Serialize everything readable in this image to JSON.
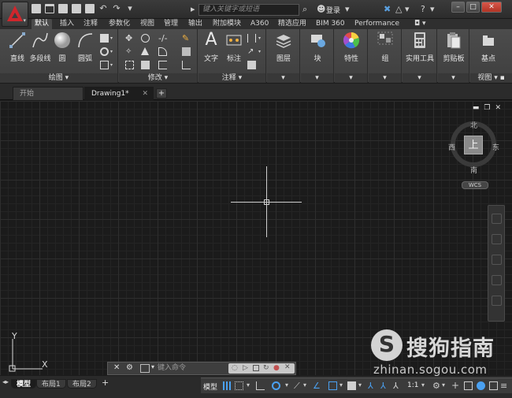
{
  "titlebar": {
    "search_placeholder": "键入关键字或短语",
    "login_label": "登录"
  },
  "ribbon_tabs": [
    {
      "label": "默认",
      "active": true
    },
    {
      "label": "插入"
    },
    {
      "label": "注释"
    },
    {
      "label": "参数化"
    },
    {
      "label": "视图"
    },
    {
      "label": "管理"
    },
    {
      "label": "输出"
    },
    {
      "label": "附加模块"
    },
    {
      "label": "A360"
    },
    {
      "label": "精选应用"
    },
    {
      "label": "BIM 360"
    },
    {
      "label": "Performance"
    }
  ],
  "ribbon": {
    "draw": {
      "title": "绘图",
      "line": "直线",
      "polyline": "多段线",
      "circle": "圆",
      "arc": "圆弧"
    },
    "modify": {
      "title": "修改"
    },
    "annotation": {
      "title": "注释",
      "text": "文字",
      "dimension": "标注"
    },
    "layers": {
      "label": "图层"
    },
    "block": {
      "label": "块"
    },
    "properties": {
      "label": "特性"
    },
    "groups": {
      "label": "组"
    },
    "utilities": {
      "label": "实用工具"
    },
    "clipboard": {
      "label": "剪贴板"
    },
    "view": {
      "label": "基点",
      "title": "视图"
    }
  },
  "file_tabs": [
    {
      "label": "开始"
    },
    {
      "label": "Drawing1*",
      "active": true
    }
  ],
  "viewcube": {
    "face": "上",
    "north": "北",
    "south": "南",
    "east": "东",
    "west": "西",
    "wcs": "WCS"
  },
  "ucs": {
    "x": "X",
    "y": "Y"
  },
  "command_line": {
    "placeholder": "键入命令"
  },
  "layout_tabs": [
    {
      "label": "模型",
      "active": true
    },
    {
      "label": "布局1"
    },
    {
      "label": "布局2"
    }
  ],
  "statusbar": {
    "model_label": "模型",
    "scale": "1:1"
  },
  "watermark": {
    "logo_letter": "S",
    "title": "搜狗指南",
    "url": "zhinan.sogou.com"
  }
}
